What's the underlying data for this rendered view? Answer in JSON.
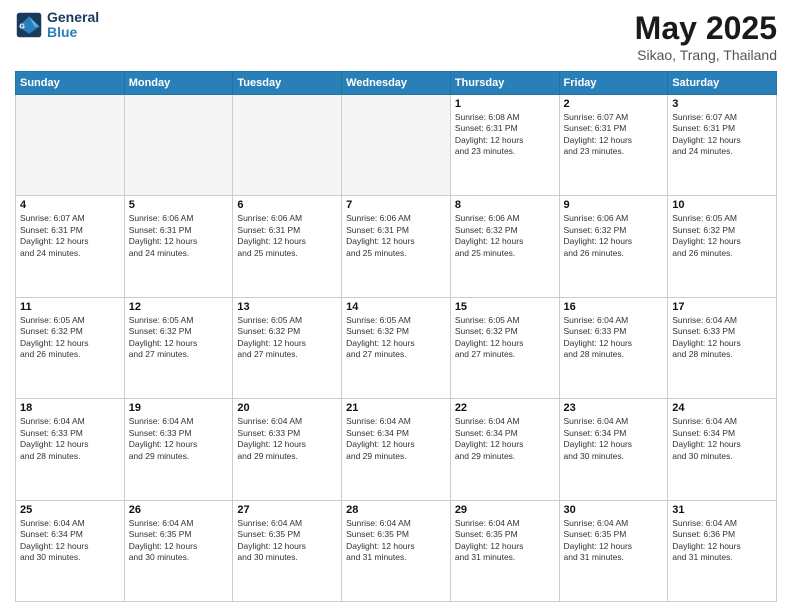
{
  "header": {
    "logo_line1": "General",
    "logo_line2": "Blue",
    "title": "May 2025",
    "location": "Sikao, Trang, Thailand"
  },
  "weekdays": [
    "Sunday",
    "Monday",
    "Tuesday",
    "Wednesday",
    "Thursday",
    "Friday",
    "Saturday"
  ],
  "days": [
    {
      "num": "",
      "info": ""
    },
    {
      "num": "",
      "info": ""
    },
    {
      "num": "",
      "info": ""
    },
    {
      "num": "",
      "info": ""
    },
    {
      "num": "1",
      "info": "Sunrise: 6:08 AM\nSunset: 6:31 PM\nDaylight: 12 hours\nand 23 minutes."
    },
    {
      "num": "2",
      "info": "Sunrise: 6:07 AM\nSunset: 6:31 PM\nDaylight: 12 hours\nand 23 minutes."
    },
    {
      "num": "3",
      "info": "Sunrise: 6:07 AM\nSunset: 6:31 PM\nDaylight: 12 hours\nand 24 minutes."
    },
    {
      "num": "4",
      "info": "Sunrise: 6:07 AM\nSunset: 6:31 PM\nDaylight: 12 hours\nand 24 minutes."
    },
    {
      "num": "5",
      "info": "Sunrise: 6:06 AM\nSunset: 6:31 PM\nDaylight: 12 hours\nand 24 minutes."
    },
    {
      "num": "6",
      "info": "Sunrise: 6:06 AM\nSunset: 6:31 PM\nDaylight: 12 hours\nand 25 minutes."
    },
    {
      "num": "7",
      "info": "Sunrise: 6:06 AM\nSunset: 6:31 PM\nDaylight: 12 hours\nand 25 minutes."
    },
    {
      "num": "8",
      "info": "Sunrise: 6:06 AM\nSunset: 6:32 PM\nDaylight: 12 hours\nand 25 minutes."
    },
    {
      "num": "9",
      "info": "Sunrise: 6:06 AM\nSunset: 6:32 PM\nDaylight: 12 hours\nand 26 minutes."
    },
    {
      "num": "10",
      "info": "Sunrise: 6:05 AM\nSunset: 6:32 PM\nDaylight: 12 hours\nand 26 minutes."
    },
    {
      "num": "11",
      "info": "Sunrise: 6:05 AM\nSunset: 6:32 PM\nDaylight: 12 hours\nand 26 minutes."
    },
    {
      "num": "12",
      "info": "Sunrise: 6:05 AM\nSunset: 6:32 PM\nDaylight: 12 hours\nand 27 minutes."
    },
    {
      "num": "13",
      "info": "Sunrise: 6:05 AM\nSunset: 6:32 PM\nDaylight: 12 hours\nand 27 minutes."
    },
    {
      "num": "14",
      "info": "Sunrise: 6:05 AM\nSunset: 6:32 PM\nDaylight: 12 hours\nand 27 minutes."
    },
    {
      "num": "15",
      "info": "Sunrise: 6:05 AM\nSunset: 6:32 PM\nDaylight: 12 hours\nand 27 minutes."
    },
    {
      "num": "16",
      "info": "Sunrise: 6:04 AM\nSunset: 6:33 PM\nDaylight: 12 hours\nand 28 minutes."
    },
    {
      "num": "17",
      "info": "Sunrise: 6:04 AM\nSunset: 6:33 PM\nDaylight: 12 hours\nand 28 minutes."
    },
    {
      "num": "18",
      "info": "Sunrise: 6:04 AM\nSunset: 6:33 PM\nDaylight: 12 hours\nand 28 minutes."
    },
    {
      "num": "19",
      "info": "Sunrise: 6:04 AM\nSunset: 6:33 PM\nDaylight: 12 hours\nand 29 minutes."
    },
    {
      "num": "20",
      "info": "Sunrise: 6:04 AM\nSunset: 6:33 PM\nDaylight: 12 hours\nand 29 minutes."
    },
    {
      "num": "21",
      "info": "Sunrise: 6:04 AM\nSunset: 6:34 PM\nDaylight: 12 hours\nand 29 minutes."
    },
    {
      "num": "22",
      "info": "Sunrise: 6:04 AM\nSunset: 6:34 PM\nDaylight: 12 hours\nand 29 minutes."
    },
    {
      "num": "23",
      "info": "Sunrise: 6:04 AM\nSunset: 6:34 PM\nDaylight: 12 hours\nand 30 minutes."
    },
    {
      "num": "24",
      "info": "Sunrise: 6:04 AM\nSunset: 6:34 PM\nDaylight: 12 hours\nand 30 minutes."
    },
    {
      "num": "25",
      "info": "Sunrise: 6:04 AM\nSunset: 6:34 PM\nDaylight: 12 hours\nand 30 minutes."
    },
    {
      "num": "26",
      "info": "Sunrise: 6:04 AM\nSunset: 6:35 PM\nDaylight: 12 hours\nand 30 minutes."
    },
    {
      "num": "27",
      "info": "Sunrise: 6:04 AM\nSunset: 6:35 PM\nDaylight: 12 hours\nand 30 minutes."
    },
    {
      "num": "28",
      "info": "Sunrise: 6:04 AM\nSunset: 6:35 PM\nDaylight: 12 hours\nand 31 minutes."
    },
    {
      "num": "29",
      "info": "Sunrise: 6:04 AM\nSunset: 6:35 PM\nDaylight: 12 hours\nand 31 minutes."
    },
    {
      "num": "30",
      "info": "Sunrise: 6:04 AM\nSunset: 6:35 PM\nDaylight: 12 hours\nand 31 minutes."
    },
    {
      "num": "31",
      "info": "Sunrise: 6:04 AM\nSunset: 6:36 PM\nDaylight: 12 hours\nand 31 minutes."
    }
  ]
}
